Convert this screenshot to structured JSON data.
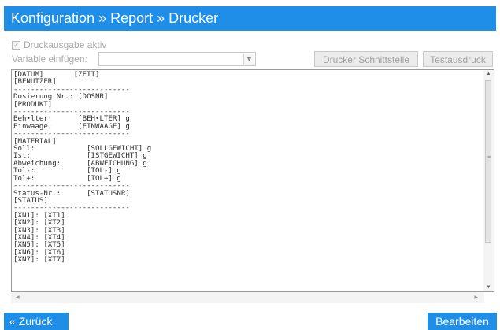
{
  "header": {
    "title": "Konfiguration » Report » Drucker"
  },
  "print_enabled": {
    "label": "Druckausgabe aktiv",
    "checked": true,
    "check_glyph": "✓"
  },
  "variable": {
    "label": "Variable einfügen:",
    "selected": ""
  },
  "buttons": {
    "interface": "Drucker Schnittstelle",
    "test_print": "Testausdruck",
    "back": "« Zurück",
    "edit": "Bearbeiten"
  },
  "editor": {
    "template": "[DATUM]       [ZEIT]\n[BENUTZER]\n---------------------------\nDosierung Nr.: [DOSNR]\n[PRODUKT]\n---------------------------\nBeh•lter:      [BEH•LTER] g\nEinwaage:      [EINWAAGE] g\n---------------------------\n[MATERIAL]\nSoll:            [SOLLGEWICHT] g\nIst:             [ISTGEWICHT] g\nAbweichung:      [ABWEICHUNG] g\nTol-:            [TOL-] g\nTol+:            [TOL+] g\n---------------------------\nStatus-Nr.:      [STATUSNR]\n[STATUS]\n---------------------------\n[XN1]: [XT1]\n[XN2]: [XT2]\n[XN3]: [XT3]\n[XN4]: [XT4]\n[XN5]: [XT5]\n[XN6]: [XT6]\n[XN7]: [XT7]"
  },
  "icons": {
    "checkbox": "checkbox-icon",
    "dropdown": "chevron-down-icon",
    "scroll_up": "arrow-up-icon",
    "scroll_down": "arrow-down-icon",
    "scroll_left": "arrow-left-icon",
    "scroll_right": "arrow-right-icon"
  },
  "colors": {
    "accent": "#1e8ee8",
    "disabled_text": "#a9a9a9"
  }
}
